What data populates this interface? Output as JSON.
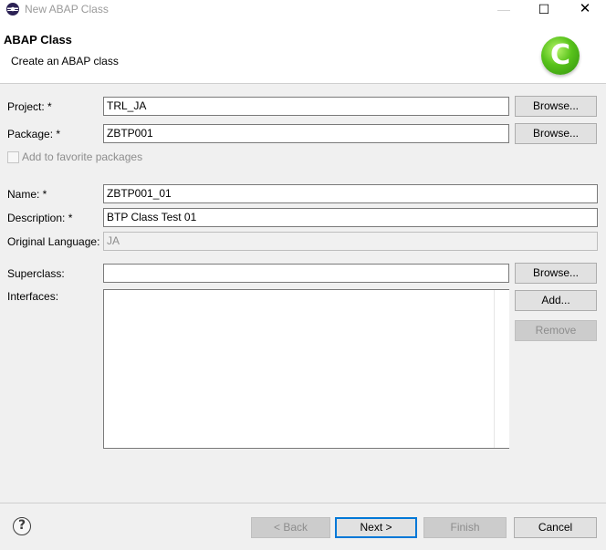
{
  "window": {
    "title": "New ABAP Class",
    "minimize_glyph": "—",
    "maximize_glyph": "☐",
    "close_glyph": "✕"
  },
  "header": {
    "title": "ABAP Class",
    "subtitle": "Create an ABAP class",
    "icon_glyph": "C",
    "icon_color": "#58c21b"
  },
  "form": {
    "project": {
      "label": "Project: *",
      "value": "TRL_JA",
      "browse_label": "Browse..."
    },
    "package": {
      "label": "Package: *",
      "value": "ZBTP001",
      "browse_label": "Browse..."
    },
    "favorite": {
      "label": "Add to favorite packages",
      "checked": false
    },
    "name": {
      "label": "Name: *",
      "value": "ZBTP001_01"
    },
    "description": {
      "label": "Description: *",
      "value": "BTP Class Test 01"
    },
    "original_language": {
      "label": "Original Language:",
      "value": "JA"
    },
    "superclass": {
      "label": "Superclass:",
      "value": "",
      "browse_label": "Browse..."
    },
    "interfaces": {
      "label": "Interfaces:",
      "add_label": "Add...",
      "remove_label": "Remove",
      "items": []
    }
  },
  "footer": {
    "help_glyph": "?",
    "back_label": "< Back",
    "next_label": "Next >",
    "finish_label": "Finish",
    "cancel_label": "Cancel"
  },
  "colors": {
    "dialog_bg": "#f0f0f0",
    "default_button_border": "#0078d7",
    "disabled_text": "#8d8d8d"
  }
}
